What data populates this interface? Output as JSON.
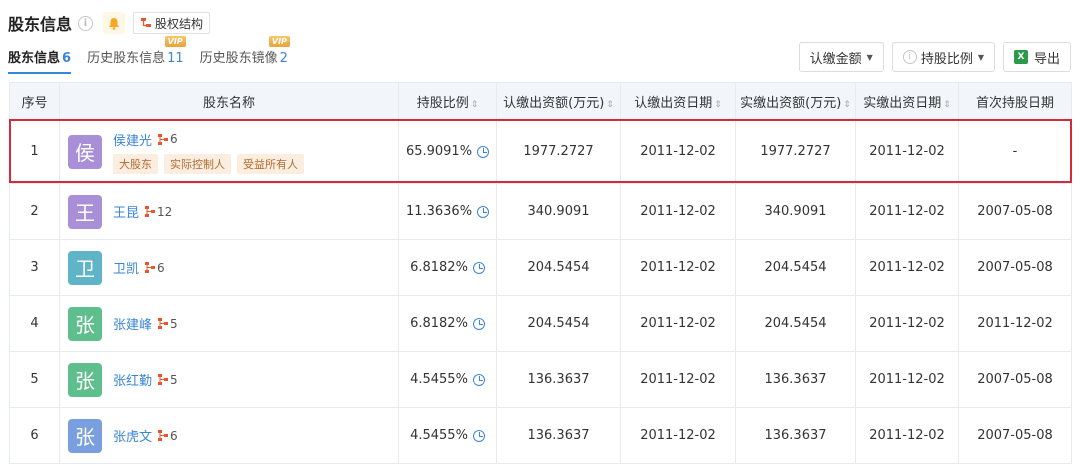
{
  "header": {
    "title": "股东信息",
    "equity_button": "股权结构"
  },
  "tabs": [
    {
      "label": "股东信息",
      "count": "6",
      "vip": ""
    },
    {
      "label": "历史股东信息",
      "count": "11",
      "vip": "VIP"
    },
    {
      "label": "历史股东镜像",
      "count": "2",
      "vip": "VIP"
    }
  ],
  "toolbar": {
    "subscribed_amount": "认缴金额",
    "holding_ratio": "持股比例",
    "export": "导出"
  },
  "columns": [
    "序号",
    "股东名称",
    "持股比例",
    "认缴出资额(万元)",
    "认缴出资日期",
    "实缴出资额(万元)",
    "实缴出资日期",
    "首次持股日期"
  ],
  "rows": [
    {
      "index": "1",
      "avatar_char": "侯",
      "avatar_color": "#a98fd8",
      "name": "侯建光",
      "rel_count": "6",
      "badges": [
        "大股东",
        "实际控制人",
        "受益所有人"
      ],
      "ratio": "65.9091%",
      "sub_amount": "1977.2727",
      "sub_date": "2011-12-02",
      "paid_amount": "1977.2727",
      "paid_date": "2011-12-02",
      "first_date": "-"
    },
    {
      "index": "2",
      "avatar_char": "王",
      "avatar_color": "#a98fd8",
      "name": "王昆",
      "rel_count": "12",
      "badges": [],
      "ratio": "11.3636%",
      "sub_amount": "340.9091",
      "sub_date": "2011-12-02",
      "paid_amount": "340.9091",
      "paid_date": "2011-12-02",
      "first_date": "2007-05-08"
    },
    {
      "index": "3",
      "avatar_char": "卫",
      "avatar_color": "#5fb5c7",
      "name": "卫凯",
      "rel_count": "6",
      "badges": [],
      "ratio": "6.8182%",
      "sub_amount": "204.5454",
      "sub_date": "2011-12-02",
      "paid_amount": "204.5454",
      "paid_date": "2011-12-02",
      "first_date": "2007-05-08"
    },
    {
      "index": "4",
      "avatar_char": "张",
      "avatar_color": "#5fbf8c",
      "name": "张建峰",
      "rel_count": "5",
      "badges": [],
      "ratio": "6.8182%",
      "sub_amount": "204.5454",
      "sub_date": "2011-12-02",
      "paid_amount": "204.5454",
      "paid_date": "2011-12-02",
      "first_date": "2011-12-02"
    },
    {
      "index": "5",
      "avatar_char": "张",
      "avatar_color": "#5fbf8c",
      "name": "张红勤",
      "rel_count": "5",
      "badges": [],
      "ratio": "4.5455%",
      "sub_amount": "136.3637",
      "sub_date": "2011-12-02",
      "paid_amount": "136.3637",
      "paid_date": "2011-12-02",
      "first_date": "2007-05-08"
    },
    {
      "index": "6",
      "avatar_char": "张",
      "avatar_color": "#7a9fe0",
      "name": "张虎文",
      "rel_count": "6",
      "badges": [],
      "ratio": "4.5455%",
      "sub_amount": "136.3637",
      "sub_date": "2011-12-02",
      "paid_amount": "136.3637",
      "paid_date": "2011-12-02",
      "first_date": "2007-05-08"
    }
  ],
  "colors": {
    "accent": "#3a86d6",
    "highlight": "#d42a3a",
    "header_bg": "#f2f6fb"
  }
}
